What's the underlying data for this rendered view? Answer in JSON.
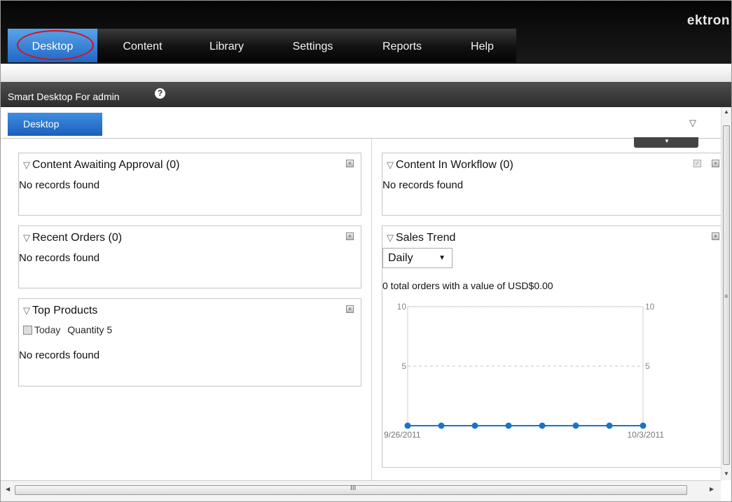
{
  "nav": {
    "tabs": [
      "Desktop",
      "Content",
      "Library",
      "Settings",
      "Reports",
      "Help"
    ],
    "active": "Desktop",
    "logo": "ektron"
  },
  "header": {
    "title": "Smart Desktop For admin",
    "help_icon": "question-circle-icon"
  },
  "desktop_tab": {
    "label": "Desktop",
    "filter_icon": "filter-triangle-icon"
  },
  "widgets": {
    "approval": {
      "title": "Content Awaiting Approval (0)",
      "body": "No records found"
    },
    "workflow": {
      "title": "Content In Workflow (0)",
      "body": "No records found"
    },
    "orders": {
      "title": "Recent Orders (0)",
      "body": "No records found"
    },
    "products": {
      "title": "Top Products",
      "period": "Today",
      "quantity": "Quantity 5",
      "body": "No records found"
    },
    "sales": {
      "title": "Sales Trend",
      "select_value": "Daily",
      "summary": "0 total orders with a value of USD$0.00"
    }
  },
  "chart_data": {
    "type": "line",
    "title": "",
    "x": [
      "9/26/2011",
      "9/27/2011",
      "9/28/2011",
      "9/29/2011",
      "9/30/2011",
      "10/1/2011",
      "10/2/2011",
      "10/3/2011"
    ],
    "x_tick_labels": [
      "9/26/2011",
      "10/3/2011"
    ],
    "series": [
      {
        "values": [
          0,
          0,
          0,
          0,
          0,
          0,
          0,
          0
        ],
        "color": "#1a73c8"
      }
    ],
    "ylim": [
      0,
      10
    ],
    "y_ticks": [
      0,
      5,
      10
    ],
    "y_tick_labels": [
      "5",
      "10"
    ],
    "grid": true
  },
  "scrollbars": {
    "h_grip": "III",
    "v_grip": "≡"
  }
}
